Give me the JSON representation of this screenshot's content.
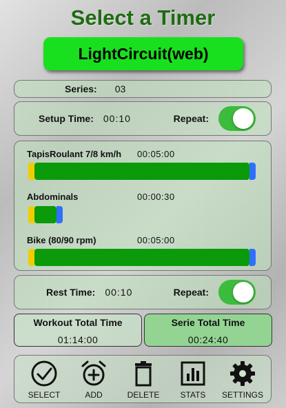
{
  "header": {
    "title": "Select a Timer"
  },
  "timer": {
    "name": "LightCircuit(web)"
  },
  "series": {
    "label": "Series:",
    "value": "03"
  },
  "setup": {
    "label": "Setup Time:",
    "value": "00:10",
    "repeat_label": "Repeat:",
    "repeat_on": true
  },
  "exercises": [
    {
      "name": "TapisRoulant 7/8 km/h",
      "time": "00:05:00"
    },
    {
      "name": "Abdominals",
      "time": "00:00:30"
    },
    {
      "name": "Bike (80/90 rpm)",
      "time": "00:05:00"
    }
  ],
  "rest": {
    "label": "Rest Time:",
    "value": "00:10",
    "repeat_label": "Repeat:",
    "repeat_on": true
  },
  "totals": {
    "workout_label": "Workout Total Time",
    "workout_value": "01:14:00",
    "serie_label": "Serie Total Time",
    "serie_value": "00:24:40"
  },
  "toolbar": [
    {
      "label": "SELECT",
      "icon": "check-circle-icon"
    },
    {
      "label": "ADD",
      "icon": "alarm-add-icon"
    },
    {
      "label": "DELETE",
      "icon": "trash-icon"
    },
    {
      "label": "STATS",
      "icon": "bar-chart-icon"
    },
    {
      "label": "SETTINGS",
      "icon": "gear-icon"
    }
  ],
  "colors": {
    "title": "#1f6b12",
    "accent": "#18e01e",
    "bar_green": "#0a9a0a",
    "bar_yellow": "#f2cc00",
    "bar_blue": "#2f6fff"
  }
}
